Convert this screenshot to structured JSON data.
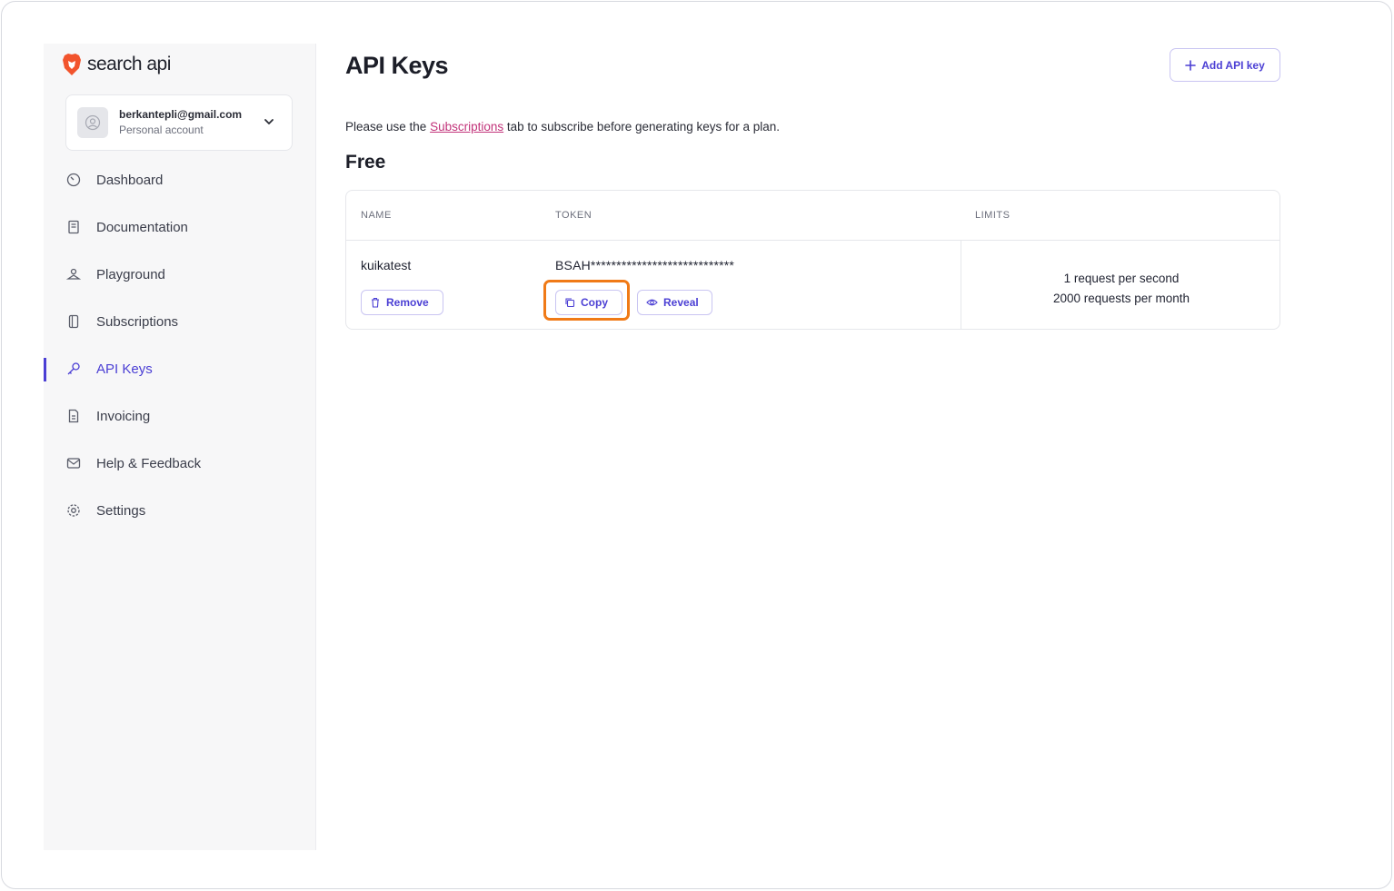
{
  "brand": {
    "name": "search api",
    "accent": "#4b3fd4",
    "logo_color": "#f2542d"
  },
  "account": {
    "email": "berkantepli@gmail.com",
    "type": "Personal account"
  },
  "sidebar": {
    "items": [
      {
        "label": "Dashboard",
        "icon": "dashboard-icon"
      },
      {
        "label": "Documentation",
        "icon": "book-icon"
      },
      {
        "label": "Playground",
        "icon": "playground-icon"
      },
      {
        "label": "Subscriptions",
        "icon": "subscriptions-icon"
      },
      {
        "label": "API Keys",
        "icon": "key-icon",
        "active": true
      },
      {
        "label": "Invoicing",
        "icon": "invoice-icon"
      },
      {
        "label": "Help & Feedback",
        "icon": "feedback-icon"
      },
      {
        "label": "Settings",
        "icon": "gear-icon"
      }
    ]
  },
  "main": {
    "title": "API Keys",
    "add_button": "Add API key",
    "notice": {
      "before": "Please use the ",
      "link": "Subscriptions",
      "after": " tab to subscribe before generating keys for a plan."
    },
    "section_title": "Free",
    "table": {
      "headers": {
        "name": "NAME",
        "token": "TOKEN",
        "limits": "LIMITS"
      },
      "row": {
        "name": "kuikatest",
        "token": "BSAH****************************",
        "limits_line1": "1 request per second",
        "limits_line2": "2000 requests per month",
        "remove_label": "Remove",
        "copy_label": "Copy",
        "reveal_label": "Reveal"
      }
    },
    "highlight_color": "#f07a17"
  }
}
